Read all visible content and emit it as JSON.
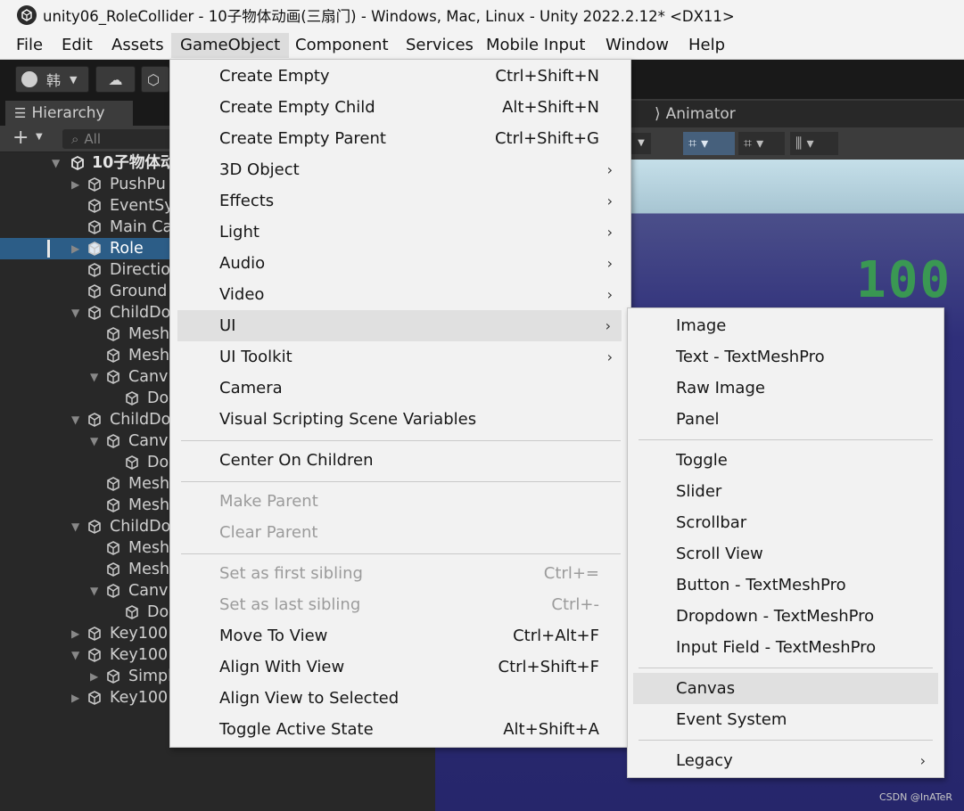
{
  "window": {
    "title": "unity06_RoleCollider - 10子物体动画(三扇门) - Windows, Mac, Linux - Unity 2022.2.12* <DX11>"
  },
  "menubar": {
    "items": [
      "File",
      "Edit",
      "Assets",
      "GameObject",
      "Component",
      "Services",
      "Mobile Input",
      "Window",
      "Help"
    ]
  },
  "toolbar": {
    "account": "韩"
  },
  "hierarchy": {
    "tab_label": "Hierarchy",
    "search_placeholder": "All",
    "scene_name": "10子物体动",
    "rows": [
      {
        "label": "PushPu"
      },
      {
        "label": "EventSy"
      },
      {
        "label": "Main Ca"
      },
      {
        "label": "Role"
      },
      {
        "label": "Directio"
      },
      {
        "label": "Ground"
      },
      {
        "label": "ChildDo"
      },
      {
        "label": "Mesh"
      },
      {
        "label": "Mesh"
      },
      {
        "label": "Canv"
      },
      {
        "label": "Do"
      },
      {
        "label": "ChildDo"
      },
      {
        "label": "Canv"
      },
      {
        "label": "Do"
      },
      {
        "label": "Mesh"
      },
      {
        "label": "Mesh"
      },
      {
        "label": "ChildDo"
      },
      {
        "label": "Mesh"
      },
      {
        "label": "Mesh"
      },
      {
        "label": "Canv"
      },
      {
        "label": "Do"
      },
      {
        "label": "Key100"
      },
      {
        "label": "Key100"
      },
      {
        "label": "Simpl"
      },
      {
        "label": "Key100"
      }
    ]
  },
  "animator": {
    "tab_label": "Animator"
  },
  "gameobject_menu": {
    "items": [
      {
        "label": "Create Empty",
        "shortcut": "Ctrl+Shift+N"
      },
      {
        "label": "Create Empty Child",
        "shortcut": "Alt+Shift+N"
      },
      {
        "label": "Create Empty Parent",
        "shortcut": "Ctrl+Shift+G"
      },
      {
        "label": "3D Object",
        "submenu": "›"
      },
      {
        "label": "Effects",
        "submenu": "›"
      },
      {
        "label": "Light",
        "submenu": "›"
      },
      {
        "label": "Audio",
        "submenu": "›"
      },
      {
        "label": "Video",
        "submenu": "›"
      },
      {
        "label": "UI",
        "submenu": "›"
      },
      {
        "label": "UI Toolkit",
        "submenu": "›"
      },
      {
        "label": "Camera"
      },
      {
        "label": "Visual Scripting Scene Variables"
      },
      {
        "label": "Center On Children"
      },
      {
        "label": "Make Parent"
      },
      {
        "label": "Clear Parent"
      },
      {
        "label": "Set as first sibling",
        "shortcut": "Ctrl+="
      },
      {
        "label": "Set as last sibling",
        "shortcut": "Ctrl+-"
      },
      {
        "label": "Move To View",
        "shortcut": "Ctrl+Alt+F"
      },
      {
        "label": "Align With View",
        "shortcut": "Ctrl+Shift+F"
      },
      {
        "label": "Align View to Selected"
      },
      {
        "label": "Toggle Active State",
        "shortcut": "Alt+Shift+A"
      }
    ]
  },
  "ui_menu": {
    "items": [
      {
        "label": "Image"
      },
      {
        "label": "Text - TextMeshPro"
      },
      {
        "label": "Raw Image"
      },
      {
        "label": "Panel"
      },
      {
        "label": "Toggle"
      },
      {
        "label": "Slider"
      },
      {
        "label": "Scrollbar"
      },
      {
        "label": "Scroll View"
      },
      {
        "label": "Button - TextMeshPro"
      },
      {
        "label": "Dropdown - TextMeshPro"
      },
      {
        "label": "Input Field - TextMeshPro"
      },
      {
        "label": "Canvas"
      },
      {
        "label": "Event System"
      },
      {
        "label": "Legacy",
        "submenu": "›"
      }
    ]
  },
  "scene": {
    "overlay_text": "100"
  },
  "watermark": "CSDN @InATeR"
}
